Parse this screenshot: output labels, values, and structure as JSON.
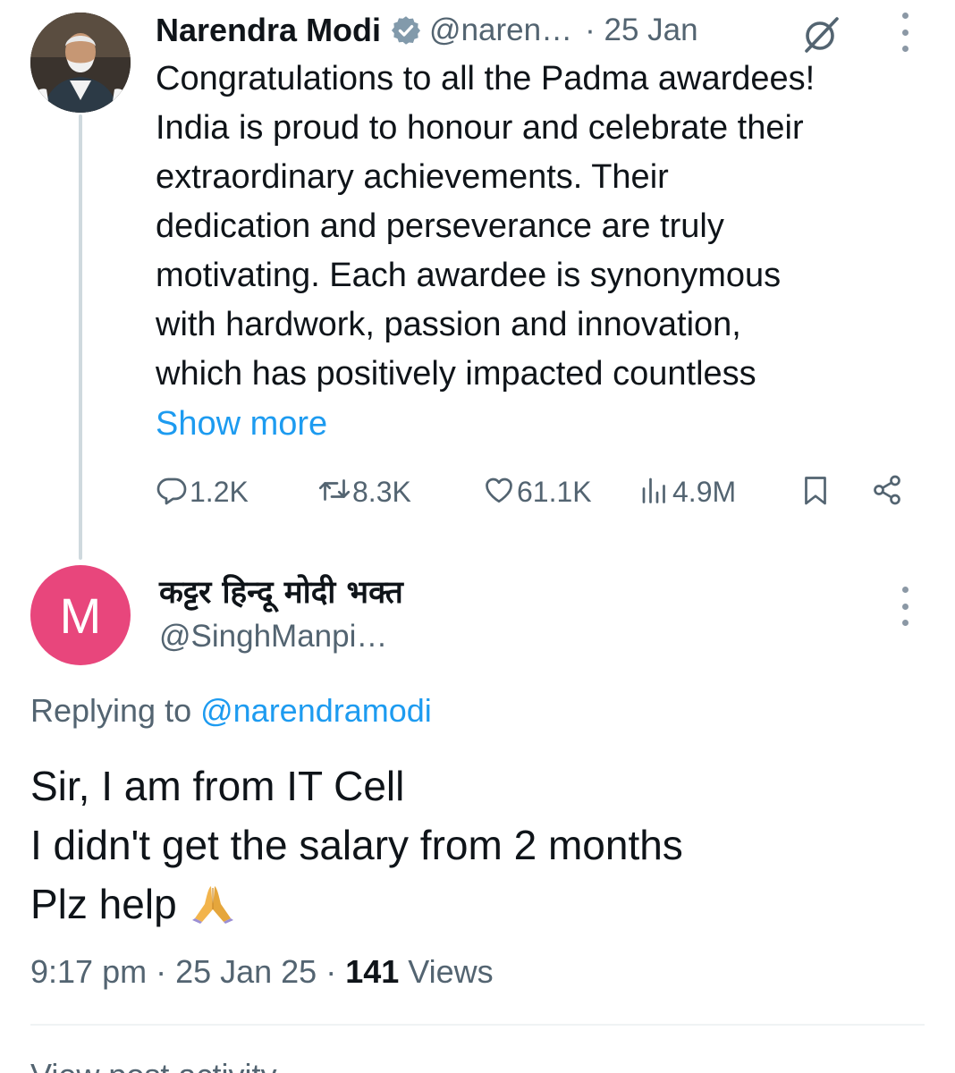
{
  "tweet": {
    "author_name": "Narendra Modi",
    "author_handle": "@naren…",
    "date": "· 25 Jan",
    "text_lines": [
      "Congratulations to all the Padma awardees!",
      "India is proud to honour and celebrate their",
      "extraordinary achievements. Their",
      "dedication and perseverance are truly",
      "motivating. Each awardee is synonymous",
      "with hardwork, passion and innovation,",
      "which has positively impacted countless"
    ],
    "show_more": "Show more",
    "stats": {
      "replies": "1.2K",
      "reposts": "8.3K",
      "likes": "61.1K",
      "views": "4.9M"
    }
  },
  "reply": {
    "avatar_letter": "M",
    "author_name": "कट्टर हिन्दू मोदी भक्त",
    "author_handle": "@SinghManpi…",
    "replying_prefix": "Replying to ",
    "replying_to": "@narendramodi",
    "text_lines": [
      "Sir, I am from IT Cell",
      "I didn't get the salary from 2 months",
      "Plz help"
    ],
    "time": "9:17 pm · 25 Jan 25 · ",
    "views_count": "141",
    "views_label": " Views"
  },
  "footer": {
    "cutoff_text": "View post activity"
  },
  "colors": {
    "accent": "#1d9bf0",
    "secondary_text": "#536471",
    "avatar_bg": "#e8467c",
    "thread_line": "#cfd9de"
  }
}
